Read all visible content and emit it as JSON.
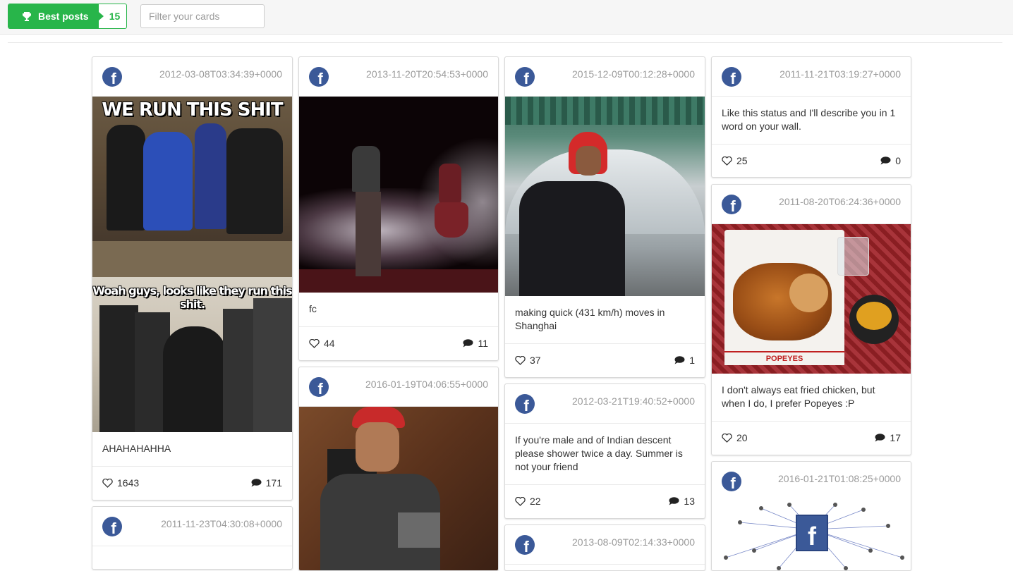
{
  "toolbar": {
    "best_label": "Best posts",
    "best_count": "15",
    "filter_placeholder": "Filter your cards"
  },
  "colors": {
    "accent": "#28b54a",
    "facebook": "#3b5998"
  },
  "cards": [
    {
      "date": "2012-03-08T03:34:39+0000",
      "text": "AHAHAHAHHA",
      "likes": "1643",
      "comments": "171",
      "image_caption_top": "WE RUN THIS SHIT",
      "image_caption_mid": "Woah guys, looks like they run this shit."
    },
    {
      "date": "2011-11-23T04:30:08+0000"
    },
    {
      "date": "2013-11-20T20:54:53+0000",
      "text": "fc",
      "likes": "44",
      "comments": "11"
    },
    {
      "date": "2016-01-19T04:06:55+0000"
    },
    {
      "date": "2015-12-09T00:12:28+0000",
      "text": "making quick (431 km/h) moves in Shanghai",
      "likes": "37",
      "comments": "1"
    },
    {
      "date": "2012-03-21T19:40:52+0000",
      "text": "If you're male and of Indian descent please shower twice a day. Summer is not your friend",
      "likes": "22",
      "comments": "13"
    },
    {
      "date": "2013-08-09T02:14:33+0000"
    },
    {
      "date": "2011-11-21T03:19:27+0000",
      "text": "Like this status and I'll describe you in 1 word on your wall.",
      "likes": "25",
      "comments": "0"
    },
    {
      "date": "2011-08-20T06:24:36+0000",
      "text": "I don't always eat fried chicken, but when I do, I prefer Popeyes :P",
      "likes": "20",
      "comments": "17",
      "image_brand": "POPEYES"
    },
    {
      "date": "2016-01-21T01:08:25+0000",
      "image_logo": "f"
    }
  ]
}
